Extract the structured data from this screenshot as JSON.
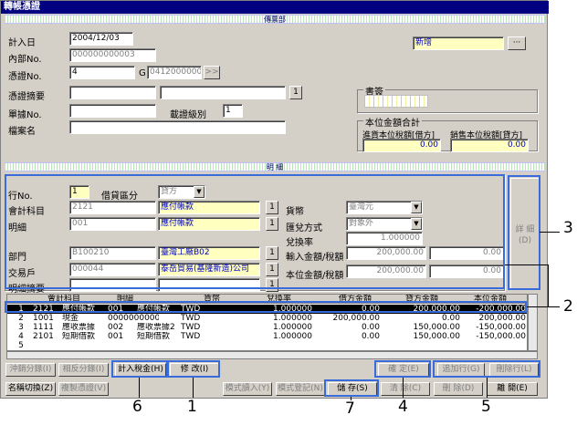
{
  "window": {
    "title": "轉帳憑證"
  },
  "header_band": "傳票部",
  "detail_band": "明 細",
  "form": {
    "date_label": "計入日",
    "date_value": "2004/12/03",
    "internal_no_label": "內部No.",
    "internal_no_value": "000000000003",
    "voucher_no_label": "憑證No.",
    "voucher_no_value": "4",
    "voucher_g": "G",
    "voucher_g_value": "041200000001",
    "summary_label": "憑證摘要",
    "slip_no_label": "單據No.",
    "doc_level_label": "載證級別",
    "doc_level_value": "1",
    "file_name_label": "檔案名",
    "status_value": "新增",
    "seal_group": "書簽",
    "local_total_group": "本位金額合計",
    "debit_total_label": "進貨本位稅額[借方]",
    "debit_total_value": "0.00",
    "credit_total_label": "銷售本位稅額[貸方]",
    "credit_total_value": "0.00"
  },
  "detail": {
    "line_no_label": "行No.",
    "line_no_value": "1",
    "dc_label": "借貸區分",
    "dc_value": "貸方",
    "account_label": "會計科目",
    "account_code": "2121",
    "account_name": "應付帳款",
    "sub_label": "明細",
    "sub_code": "001",
    "sub_name": "應付帳款",
    "currency_label": "貨幣",
    "currency_value": "臺灣元",
    "rate_method_label": "匯兌方式",
    "rate_method_value": "對象外",
    "rate_label": "兌換率",
    "rate_value": "1.000000",
    "input_amt_label": "輸入金額/稅額",
    "input_amt_value": "200,000.00",
    "input_tax_value": "0.00",
    "local_amt_label": "本位金額/稅額",
    "local_amt_value": "200,000.00",
    "local_tax_value": "0.00",
    "dept_label": "部門",
    "dept_code": "B100210",
    "dept_name": "臺灣工廠B02",
    "partner_label": "交易戶",
    "partner_code": "000044",
    "partner_name": "泰岳貿易(基隆新造)公司",
    "memo_label": "明細摘要",
    "detail_side_label": "詳 細",
    "detail_side_key": "(D)"
  },
  "table": {
    "headers": [
      "會計科目",
      "明細",
      "貨幣",
      "兌換率",
      "借方金額",
      "貸方金額",
      "本位金額"
    ],
    "rows": [
      [
        "1",
        "2121",
        "應付帳款",
        "001",
        "應付帳款",
        "TWD",
        "1.000000",
        "0.00",
        "200,000.00",
        "-200,000.00"
      ],
      [
        "2",
        "1001",
        "現金",
        "000000000000",
        "",
        "TWD",
        "1.000000",
        "200,000.00",
        "0.00",
        "200,000.00"
      ],
      [
        "3",
        "1111",
        "應收票據",
        "002",
        "應收票據2",
        "TWD",
        "1.000000",
        "0.00",
        "150,000.00",
        "-150,000.00"
      ],
      [
        "4",
        "2101",
        "短期借款",
        "001",
        "短期借款",
        "TWD",
        "1.000000",
        "0.00",
        "150,000.00",
        "-150,000.00"
      ],
      [
        "5",
        "",
        "",
        "",
        "",
        "",
        "",
        "",
        "",
        ""
      ]
    ]
  },
  "buttons": {
    "split_dc": "沖銷分錄(I)",
    "opposite": "相反分錄(I)",
    "tax": "計入稅金(H)",
    "modify": "修 改(I)",
    "confirm": "確 定(E)",
    "add_row": "追加行(G)",
    "delete_row": "刪除行(L)",
    "name_switch": "名稱切換(Z)",
    "copy": "複製憑證(V)",
    "template_read": "模式讀入(Y)",
    "template_reg": "模式登記(N)",
    "save": "儲 存(S)",
    "clear": "清 除(C)",
    "remove": "刪 除(D)",
    "close": "離 開(E)"
  },
  "callouts": [
    "1",
    "2",
    "3",
    "4",
    "5",
    "6",
    "7"
  ]
}
